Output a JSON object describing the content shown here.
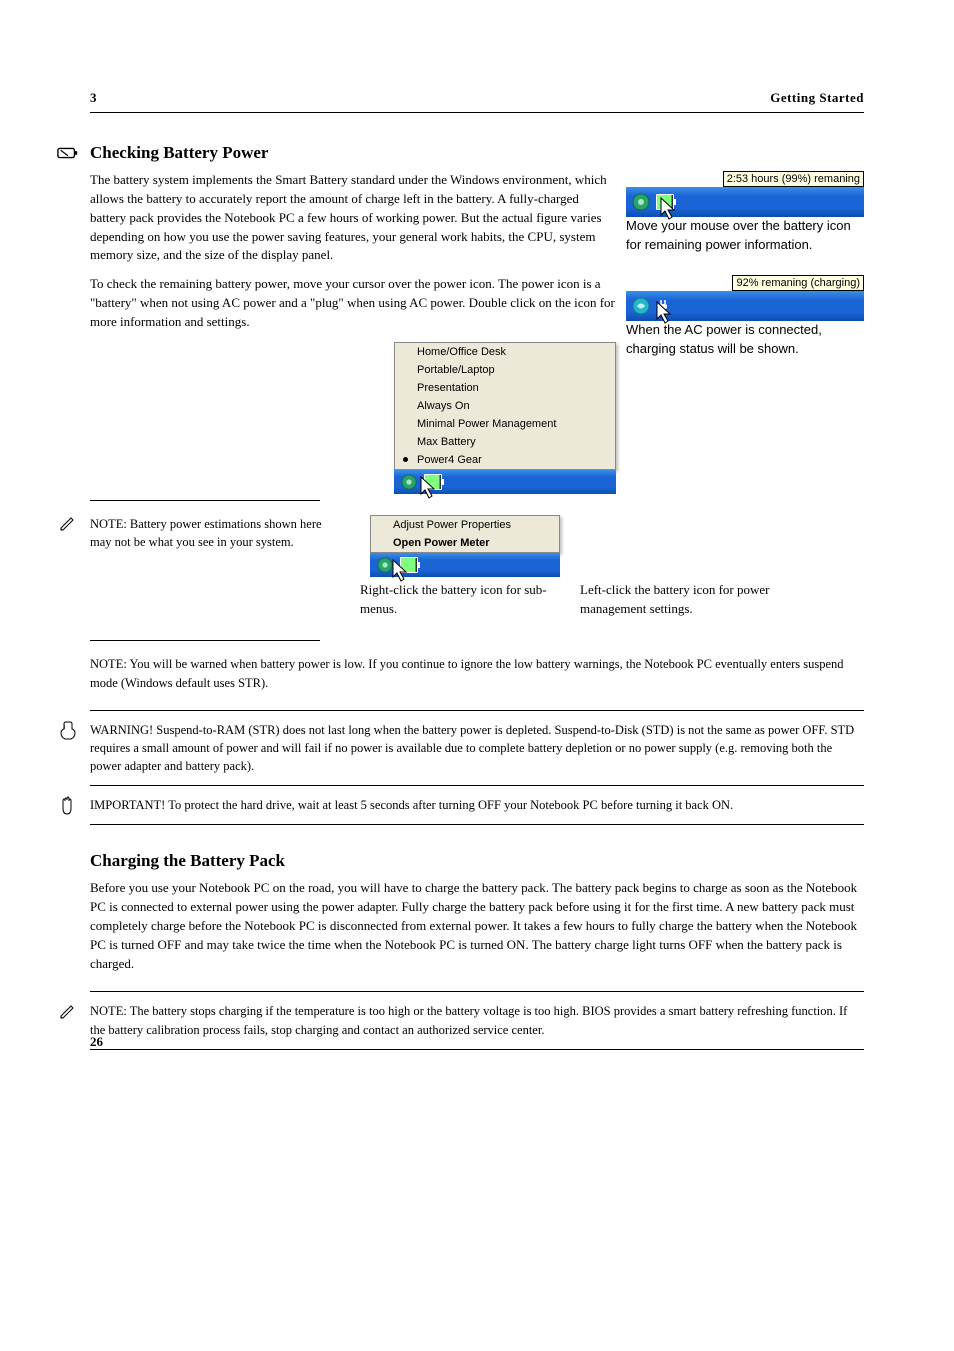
{
  "header": {
    "left": "3",
    "right": "Getting Started"
  },
  "sections": {
    "check": {
      "title": "Checking Battery Power",
      "paragraphs": [
        "The battery system implements the Smart Battery standard under the Windows environment, which allows the battery to accurately report the amount of charge left in the battery. A fully-charged battery pack provides the Notebook PC a few hours of working power. But the actual figure varies depending on how you use the power saving features, your general work habits, the CPU, system memory size, and the size of the display panel.",
        "To check the remaining battery power, move your cursor over the power icon. The power icon is a \"battery\" when not using AC power and a \"plug\" when using AC power. Double click on the icon for more information and settings."
      ]
    },
    "charge": {
      "title": "Charging the Battery Pack",
      "body": "Before you use your Notebook PC on the road, you will have to charge the battery pack. The battery pack begins to charge as soon as the Notebook PC is connected to external power using the power adapter. Fully charge the battery pack before using it for the first time. A new battery pack must completely charge before the Notebook PC is disconnected from external power. It takes a few hours to fully charge the battery when the Notebook PC is turned OFF and may take twice the time when the Notebook PC is turned ON. The battery charge light turns OFF when the battery pack is charged."
    }
  },
  "tray": {
    "tooltip1": "2:53 hours (99%) remaning",
    "caption1": "Move your mouse over the battery icon for remaining power information.",
    "tooltip2": "92% remaning (charging)",
    "caption2": "When the AC power is connected, charging status will be shown.",
    "caption3": "Right-click the battery icon for sub-menus.",
    "caption4": "Left-click the battery icon for power management settings."
  },
  "context_menu_small": {
    "items": [
      {
        "label": "Adjust Power Properties",
        "bold": false
      },
      {
        "label": "Open Power Meter",
        "bold": true
      }
    ]
  },
  "context_menu_large": {
    "items": [
      {
        "label": "Home/Office Desk"
      },
      {
        "label": "Portable/Laptop"
      },
      {
        "label": "Presentation"
      },
      {
        "label": "Always On"
      },
      {
        "label": "Minimal Power Management"
      },
      {
        "label": "Max Battery"
      },
      {
        "label": "Power4 Gear",
        "selected": true
      }
    ]
  },
  "notes": {
    "note1a": "NOTE: Battery power estimations shown here may not be what you see in your system.",
    "note1b": "NOTE: You will be warned when battery power is low. If you continue to ignore the low battery warnings, the Notebook PC eventually enters suspend mode (Windows default uses STR).",
    "warning": "WARNING! Suspend-to-RAM (STR) does not last long when the battery power is depleted. Suspend-to-Disk (STD) is not the same as power OFF. STD requires a small amount of power and will fail if no power is available due to complete battery depletion or no power supply (e.g. removing both the power adapter and battery pack).",
    "important": "IMPORTANT! To protect the hard drive, wait at least 5 seconds after turning OFF your Notebook PC before turning it back ON.",
    "note2": "NOTE: The battery stops charging if the temperature is too high or the battery voltage is too high. BIOS provides a smart battery refreshing function. If the battery calibration process fails, stop charging and contact an authorized service center."
  },
  "footer": {
    "page": "26"
  }
}
